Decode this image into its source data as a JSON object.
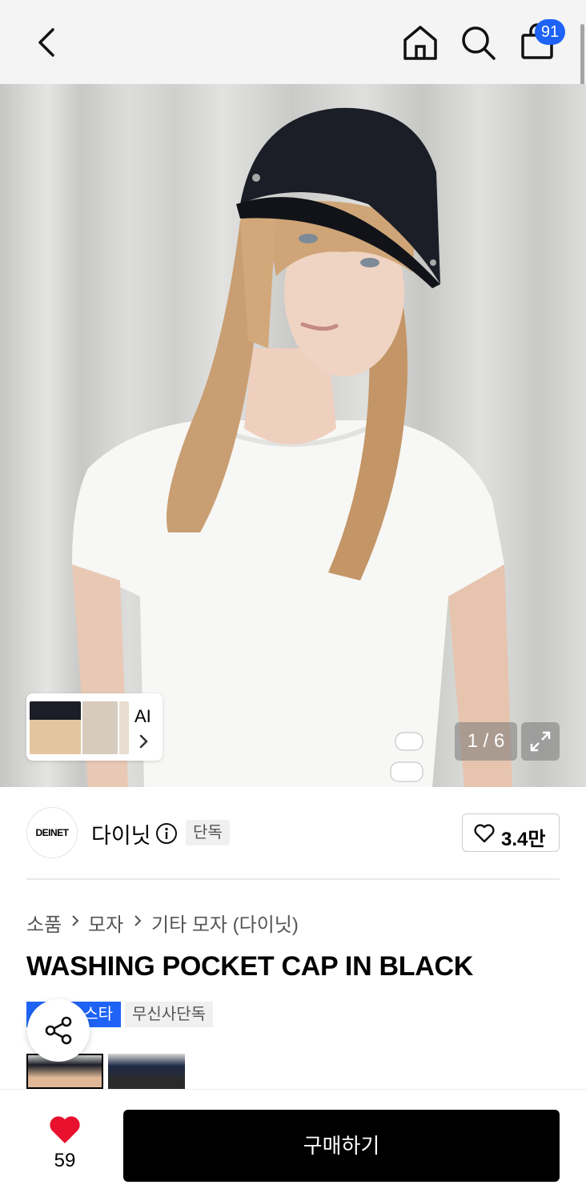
{
  "header": {
    "cart_count": "91",
    "icons": [
      "back-arrow-icon",
      "home-icon",
      "search-icon",
      "shopping-bag-icon"
    ]
  },
  "gallery": {
    "ai_label": "AI",
    "counter": "1 / 6"
  },
  "brand": {
    "logo_text": "DEINET",
    "name": "다이닛",
    "exclusive_tag": "단독",
    "likes": "3.4만"
  },
  "breadcrumb": [
    "소품",
    "모자",
    "기타 모자 (다이닛)"
  ],
  "product": {
    "title": "WASHING POCKET CAP IN BLACK",
    "tag_primary": "스타",
    "tag_secondary": "무신사단독"
  },
  "bottom_bar": {
    "like_count": "59",
    "buy_label": "구매하기"
  },
  "colors": {
    "accent": "#1e63f6",
    "heart": "#e8112d",
    "button": "#000000"
  }
}
